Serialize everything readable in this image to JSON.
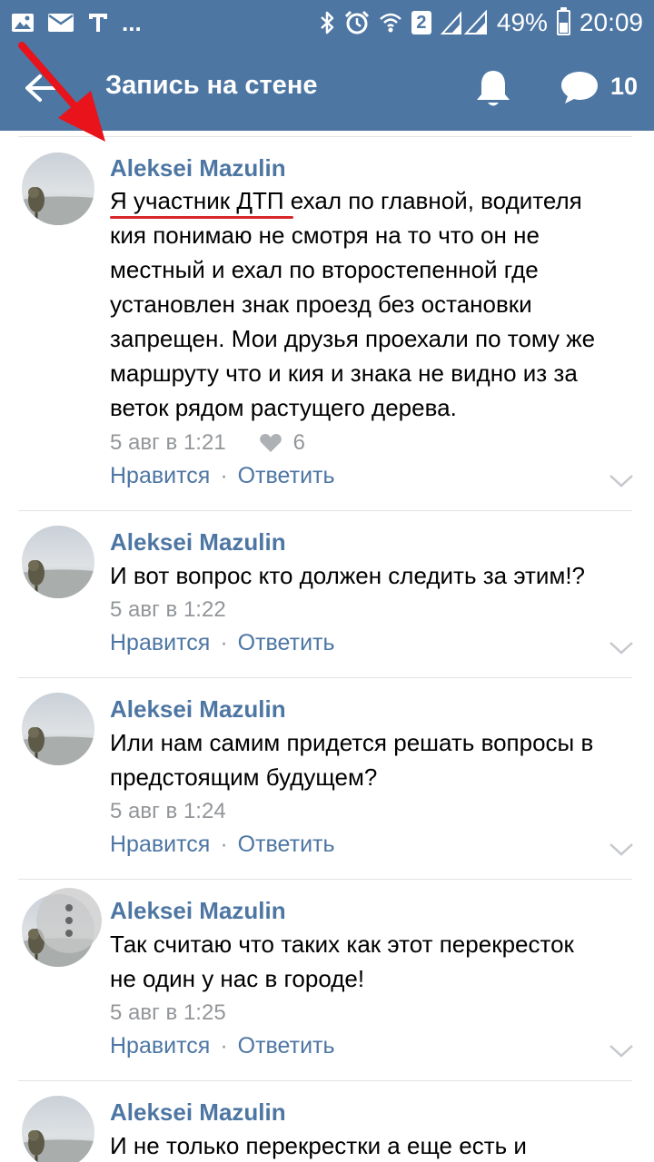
{
  "status_bar": {
    "more": "...",
    "sim_badge": "2",
    "battery": "49%",
    "battery_level": 0.49,
    "time": "20:09",
    "icons": [
      "image-icon",
      "mail-icon",
      "text-icon",
      "bluetooth-icon",
      "alarm-icon",
      "wifi-icon",
      "signal-icon"
    ]
  },
  "header": {
    "title": "Запись на стене",
    "comment_count": "10",
    "color": "#4d76a3"
  },
  "colors": {
    "link": "#4d76a3",
    "meta": "#939699",
    "annotation": "#d8262a"
  },
  "comments": [
    {
      "author": "Aleksei Mazulin",
      "lines": [
        "Я участник ДТП ехал по главной, водителя",
        "кия понимаю не смотря на то что он не",
        "местный и ехал по второстепенной где",
        "установлен знак проезд без остановки",
        "запрещен. Мои друзья проехали по тому же",
        "маршруту что и кия и знака не видно из за",
        "веток рядом растущего дерева."
      ],
      "time": "5 авг в 1:21",
      "likes": "6",
      "like_label": "Нравится",
      "reply_label": "Ответить"
    },
    {
      "author": "Aleksei Mazulin",
      "lines": [
        "И вот вопрос кто должен следить за этим!?"
      ],
      "time": "5 авг в 1:22",
      "like_label": "Нравится",
      "reply_label": "Ответить"
    },
    {
      "author": "Aleksei Mazulin",
      "lines": [
        "Или нам самим придется решать вопросы в",
        "предстоящим будущем?"
      ],
      "time": "5 авг в 1:24",
      "like_label": "Нравится",
      "reply_label": "Ответить"
    },
    {
      "author": "Aleksei Mazulin",
      "lines": [
        "Так считаю что таких как этот перекресток",
        "не один у нас в городе!"
      ],
      "time": "5 авг в 1:25",
      "like_label": "Нравится",
      "reply_label": "Ответить"
    },
    {
      "author": "Aleksei Mazulin",
      "lines": [
        "И не только перекрестки а еще есть и"
      ]
    }
  ]
}
